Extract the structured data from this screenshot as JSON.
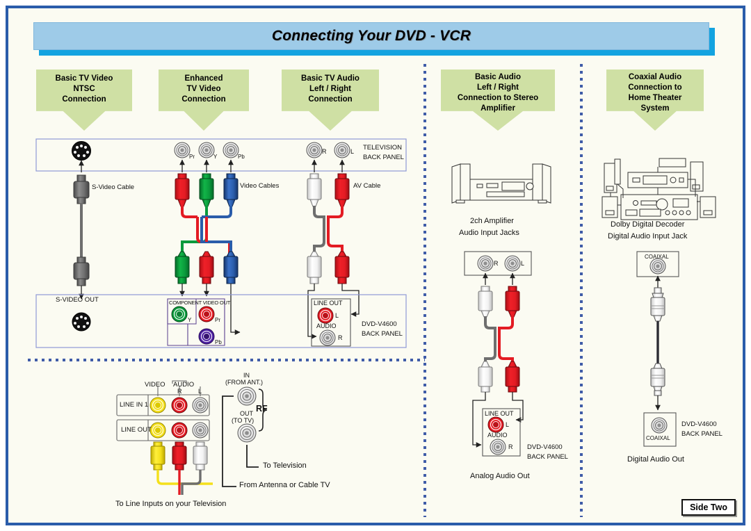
{
  "banner": {
    "title": "Connecting Your DVD - VCR"
  },
  "columns": [
    {
      "id": "basic-tv-video",
      "header": [
        "Basic TV Video",
        "NTSC",
        "Connection"
      ]
    },
    {
      "id": "enhanced-video",
      "header": [
        "Enhanced",
        "TV Video",
        "Connection"
      ]
    },
    {
      "id": "basic-tv-audio",
      "header": [
        "Basic TV Audio",
        "Left / Right",
        "Connection"
      ]
    },
    {
      "id": "basic-audio-amp",
      "header": [
        "Basic Audio",
        "Left / Right",
        "Connection to Stereo",
        "Amplifier"
      ]
    },
    {
      "id": "coaxial-audio",
      "header": [
        "Coaxial Audio",
        "Connection to",
        "Home Theater",
        "System"
      ]
    }
  ],
  "television_panel": {
    "label_line1": "TELEVISION",
    "label_line2": "BACK PANEL",
    "component_jacks": [
      "Pr",
      "Y",
      "Pb"
    ],
    "audio_jacks": [
      "R",
      "L"
    ]
  },
  "dvd_panel": {
    "label_line1": "DVD-V4600",
    "label_line2": "BACK PANEL",
    "svideo_out": "S-VIDEO OUT",
    "component_title": "COMPONENT VIDEO OUT",
    "component_jacks": [
      "Y",
      "Pr",
      "Pb"
    ],
    "line_out_title": "LINE OUT",
    "audio_title": "AUDIO",
    "audio_jacks": [
      "L",
      "R"
    ]
  },
  "cables": {
    "svideo": "S-Video Cable",
    "video": "Video Cables",
    "av": "AV Cable"
  },
  "vcr_panel": {
    "video_label": "VIDEO",
    "audio_label": "AUDIO",
    "audio_r": "R",
    "audio_l": "L",
    "line_in_1": "LINE IN 1",
    "line_out": "LINE OUT",
    "rf_label": "RF",
    "rf_in_line1": "IN",
    "rf_in_line2": "(FROM ANT.)",
    "rf_out_line1": "OUT",
    "rf_out_line2": "(TO TV)",
    "note_to_television": "To Television",
    "note_from_antenna": "From Antenna or Cable TV",
    "note_line_inputs": "To Line Inputs on your Television"
  },
  "amplifier": {
    "caption_line1": "2ch Amplifier",
    "caption_line2": "Audio Input Jacks",
    "input_jacks": [
      "R",
      "L"
    ],
    "line_out_title": "LINE OUT",
    "audio_title": "AUDIO",
    "audio_jacks": [
      "L",
      "R"
    ],
    "panel_line1": "DVD-V4600",
    "panel_line2": "BACK PANEL",
    "bottom_caption": "Analog Audio Out"
  },
  "home_theater": {
    "caption_line1": "Dolby Digital Decoder",
    "caption_line2": "Digital Audio Input Jack",
    "coax_in_label": "COAIXAL",
    "coax_out_label": "COAIXAL",
    "panel_line1": "DVD-V4600",
    "panel_line2": "BACK PANEL",
    "bottom_caption": "Digital Audio Out"
  },
  "footer": {
    "side_badge": "Side Two"
  },
  "colors": {
    "frame": "#2a5caa",
    "background": "#fbfbf2",
    "banner_fill": "#9ecbe8",
    "banner_shadow": "#13a3e0",
    "header_green": "#cfe0a4",
    "panel_border": "#8f9ad6",
    "dot_blue": "#3f5ca8",
    "red": "#e31b23",
    "green": "#0a9a3c",
    "blue": "#2a5caa",
    "purple": "#4b1e9e",
    "yellow": "#f4e01b",
    "white": "#ffffff",
    "gray": "#6e6e6e"
  }
}
